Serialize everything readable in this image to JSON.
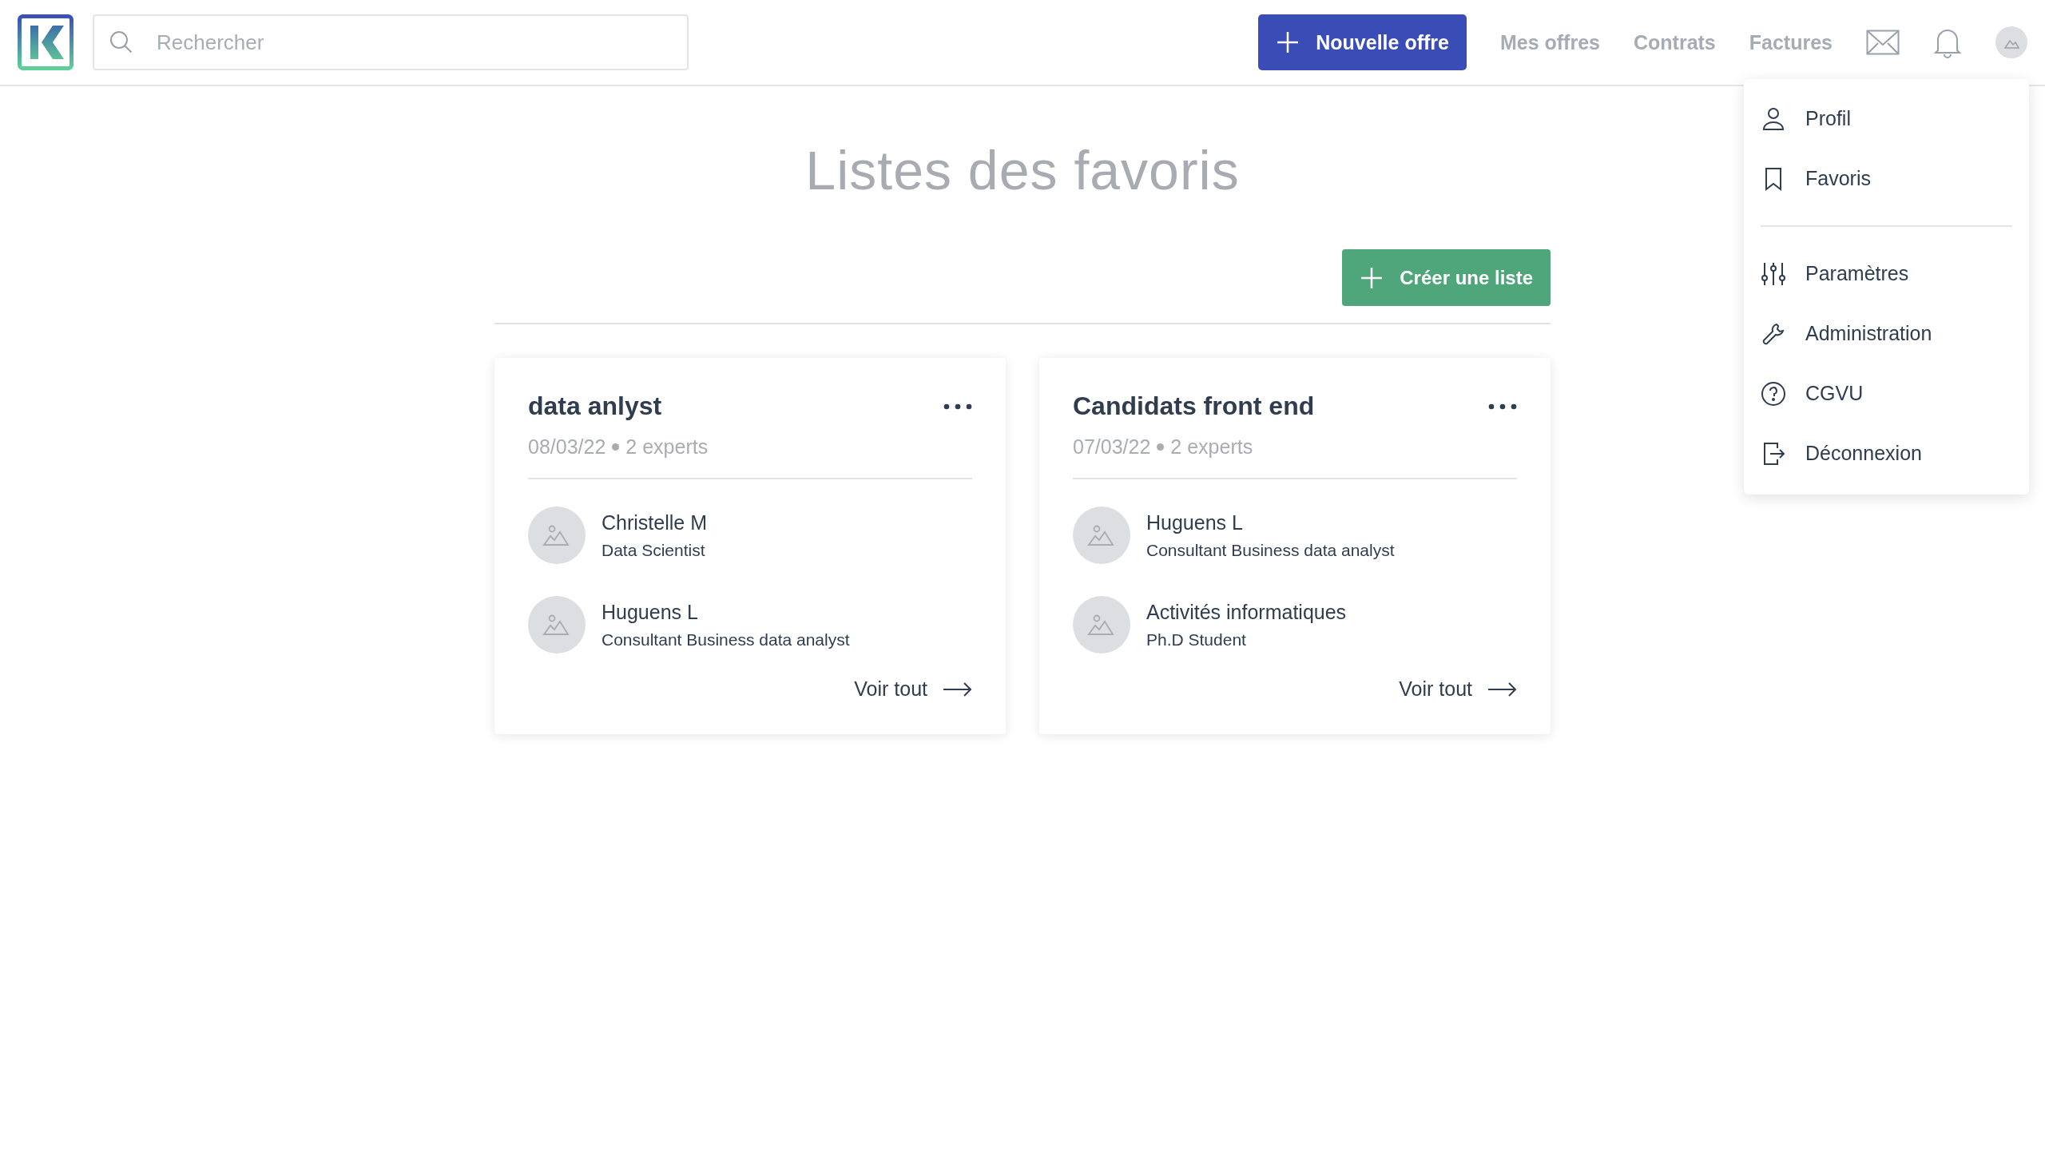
{
  "header": {
    "search": {
      "placeholder": "Rechercher"
    },
    "new_button": "Nouvelle offre",
    "nav": [
      "Mes offres",
      "Contrats",
      "Factures"
    ]
  },
  "user_menu": {
    "groups": [
      [
        "Profil",
        "Favoris"
      ],
      [
        "Paramètres",
        "Administration",
        "CGVU",
        "Déconnexion"
      ]
    ]
  },
  "page": {
    "title": "Listes des favoris",
    "create_button": "Créer une liste"
  },
  "lists": [
    {
      "title": "data anlyst",
      "date": "08/03/22",
      "count": "2 experts",
      "experts": [
        {
          "name": "Christelle M",
          "role": "Data Scientist"
        },
        {
          "name": "Huguens L",
          "role": "Consultant Business data analyst"
        }
      ],
      "link": "Voir tout"
    },
    {
      "title": "Candidats front end",
      "date": "07/03/22",
      "count": "2 experts",
      "experts": [
        {
          "name": "Huguens L",
          "role": "Consultant Business data analyst"
        },
        {
          "name": "Activités informatiques",
          "role": "Ph.D Student"
        }
      ],
      "link": "Voir tout"
    }
  ]
}
